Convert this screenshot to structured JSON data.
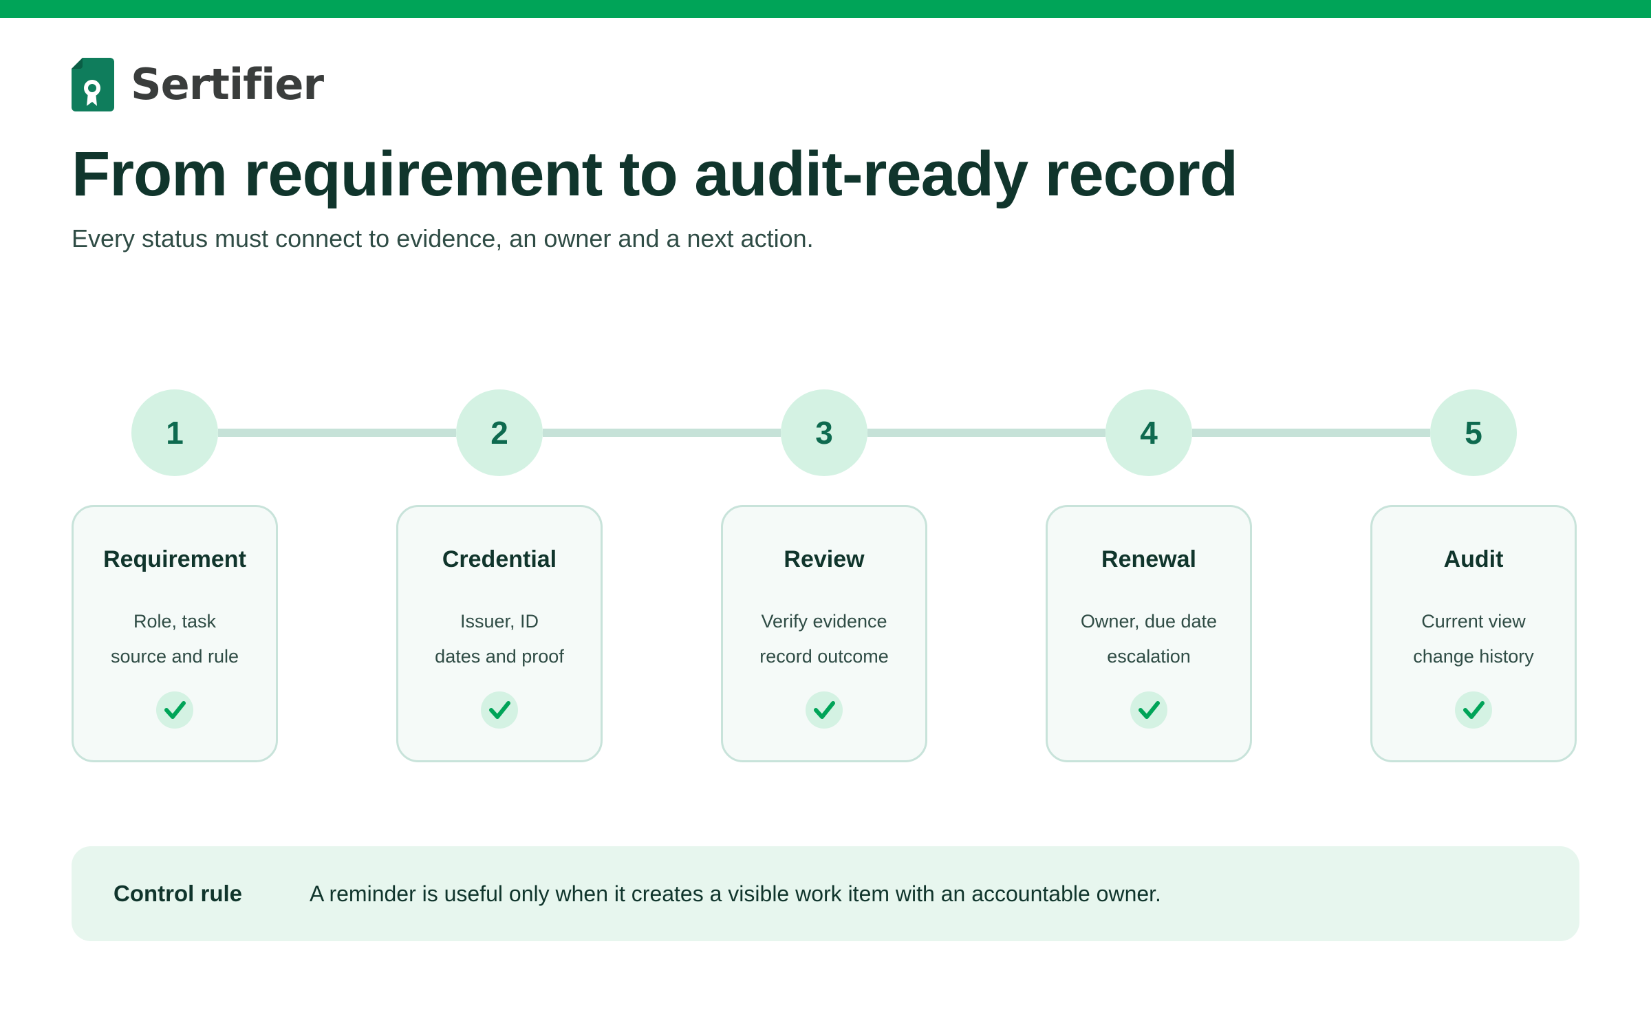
{
  "brand": {
    "name": "Sertifier",
    "logo_icon": "certificate-ribbon-icon",
    "color": "#0f7d5c"
  },
  "header": {
    "title": "From requirement to audit-ready record",
    "subtitle": "Every status must connect to evidence, an owner and a next action."
  },
  "steps": [
    {
      "number": "1",
      "title": "Requirement",
      "line1": "Role, task",
      "line2": "source and rule",
      "status_icon": "check-icon"
    },
    {
      "number": "2",
      "title": "Credential",
      "line1": "Issuer, ID",
      "line2": "dates and proof",
      "status_icon": "check-icon"
    },
    {
      "number": "3",
      "title": "Review",
      "line1": "Verify evidence",
      "line2": "record outcome",
      "status_icon": "check-icon"
    },
    {
      "number": "4",
      "title": "Renewal",
      "line1": "Owner, due date",
      "line2": "escalation",
      "status_icon": "check-icon"
    },
    {
      "number": "5",
      "title": "Audit",
      "line1": "Current view",
      "line2": "change history",
      "status_icon": "check-icon"
    }
  ],
  "control_rule": {
    "label": "Control rule",
    "text": "A reminder is useful only when it creates a visible work item with an accountable owner."
  },
  "colors": {
    "accent": "#00a458",
    "title": "#10352c",
    "step_circle": "#d4f2e3",
    "card_border": "#c8e3da",
    "rule_background": "#e7f6ee"
  }
}
